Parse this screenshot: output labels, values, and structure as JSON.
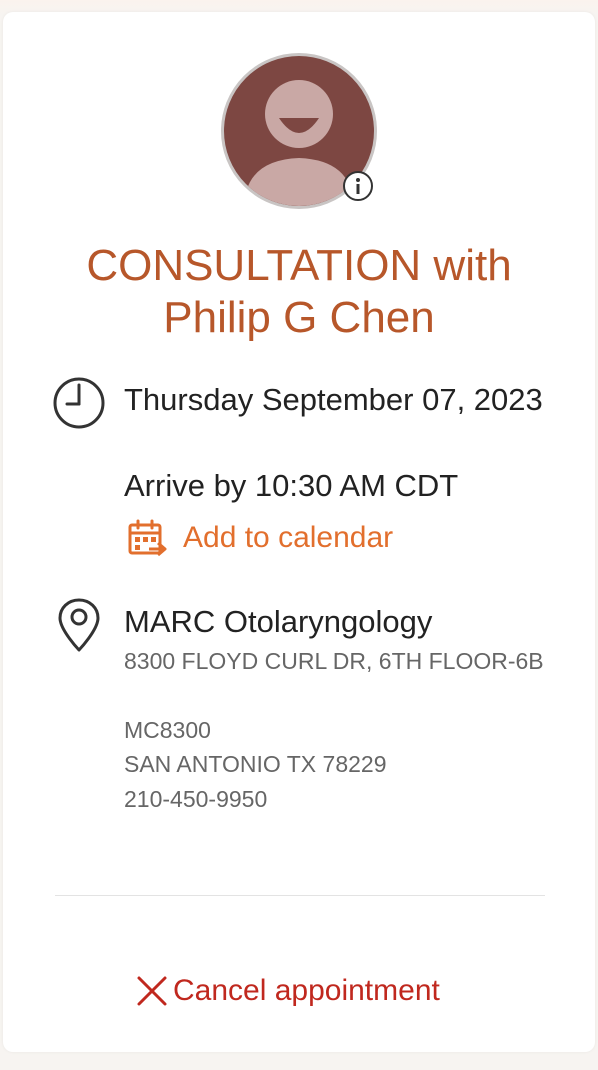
{
  "appointment": {
    "title": "CONSULTATION with Philip G Chen",
    "date": "Thursday September 07, 2023",
    "arrive": "Arrive by 10:30 AM CDT",
    "add_to_calendar_label": "Add to calendar",
    "cancel_label": "Cancel appointment"
  },
  "location": {
    "name": "MARC Otolaryngology",
    "address_line1": "8300 FLOYD CURL DR, 6TH FLOOR-6B",
    "address_line2": "MC8300",
    "city_state_zip": "SAN ANTONIO TX 78229",
    "phone": "210-450-9950"
  },
  "icons": {
    "avatar": "person-avatar-icon",
    "info": "info-icon",
    "clock": "clock-icon",
    "calendar": "calendar-add-icon",
    "pin": "location-pin-icon",
    "cancel": "x-icon"
  },
  "colors": {
    "title": "#b7572a",
    "accent": "#e26f2d",
    "danger": "#c0281e",
    "avatar_bg": "#7d4742"
  }
}
